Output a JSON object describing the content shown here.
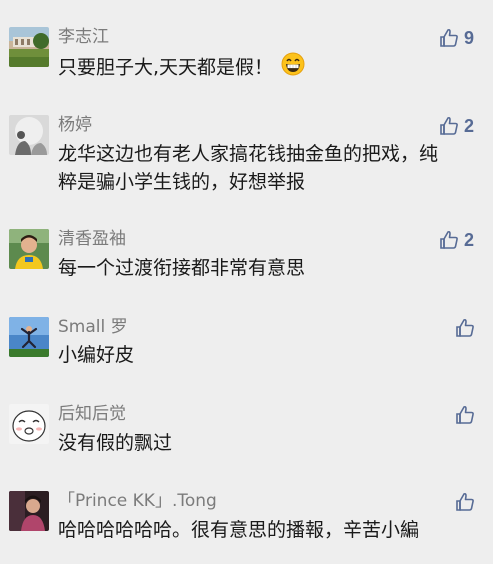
{
  "comments": [
    {
      "name": "李志江",
      "text": "只要胆子大,天天都是假！",
      "emoji": "grinning-face-emoji",
      "likes": "9",
      "avatar": "garden-photo-avatar"
    },
    {
      "name": "杨婷",
      "text_line1": "龙华这边也有老人家搞花钱抽金鱼的把戏，纯",
      "text_line2": "粹是骗小学生钱的，好想举报",
      "likes": "2",
      "avatar": "grey-portrait-avatar"
    },
    {
      "name": "清香盈袖",
      "text": "每一个过渡衔接都非常有意思",
      "likes": "2",
      "avatar": "person-yellow-avatar"
    },
    {
      "name": "Small 罗",
      "text": "小编好皮",
      "likes": "",
      "avatar": "jumping-sky-avatar"
    },
    {
      "name": "后知后觉",
      "text": "没有假的飘过",
      "likes": "",
      "avatar": "cartoon-face-avatar"
    },
    {
      "name": "「Prince KK」.Tong",
      "text": "哈哈哈哈哈哈。很有意思的播報，辛苦小編",
      "likes": "",
      "avatar": "dark-portrait-avatar"
    }
  ],
  "colors": {
    "background": "#eeeeee",
    "name": "#7b7b7b",
    "text": "#1a1a1a",
    "like": "#576b95"
  }
}
